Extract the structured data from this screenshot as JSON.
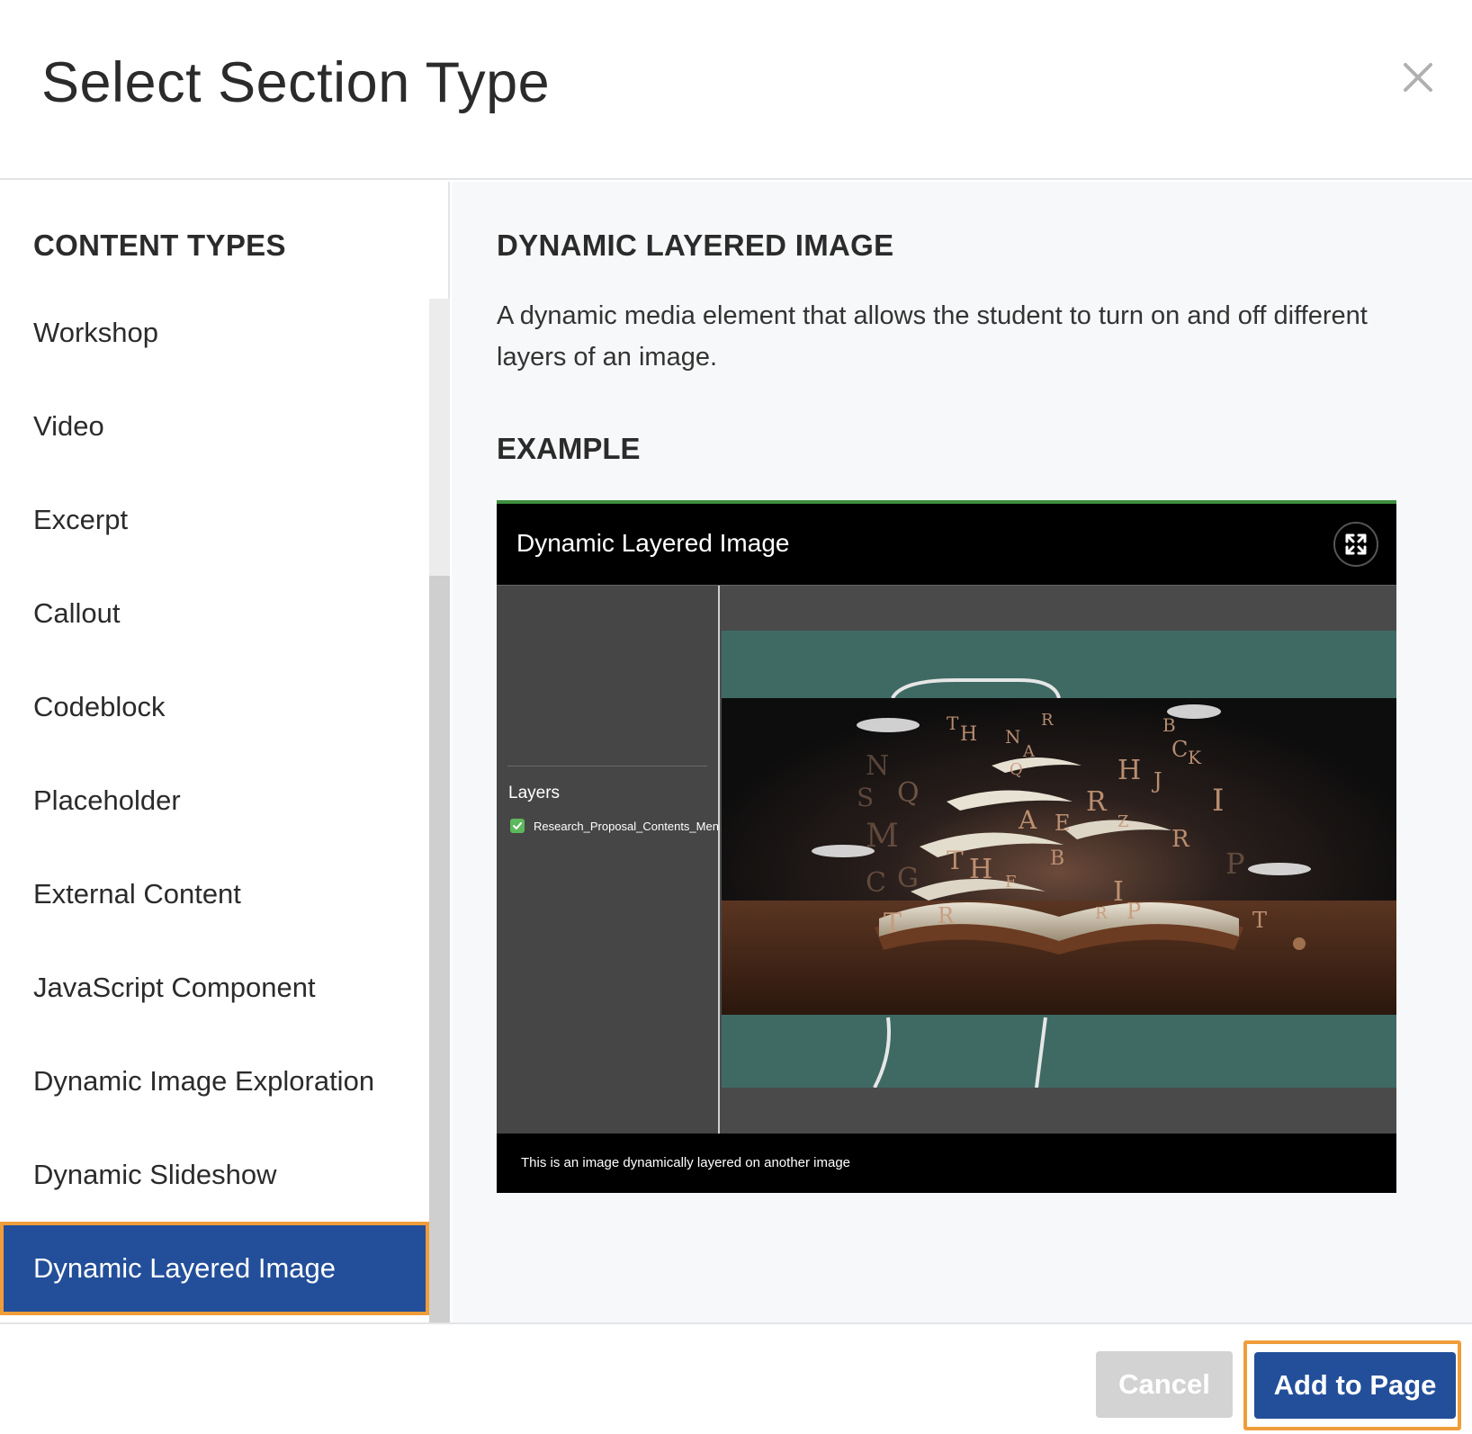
{
  "dialog": {
    "title": "Select Section Type",
    "close_icon": "close-icon"
  },
  "sidebar": {
    "heading": "CONTENT TYPES",
    "items": [
      {
        "label": "Workshop"
      },
      {
        "label": "Video"
      },
      {
        "label": "Excerpt"
      },
      {
        "label": "Callout"
      },
      {
        "label": "Codeblock"
      },
      {
        "label": "Placeholder"
      },
      {
        "label": "External Content"
      },
      {
        "label": "JavaScript Component"
      },
      {
        "label": "Dynamic Image Exploration"
      },
      {
        "label": "Dynamic Slideshow"
      },
      {
        "label": "Dynamic Layered Image"
      }
    ],
    "selected_item": "Dynamic Layered Image"
  },
  "detail": {
    "title": "DYNAMIC LAYERED IMAGE",
    "description": "A dynamic media element that allows the student to turn on and off different layers of an image.",
    "example_heading": "EXAMPLE",
    "example": {
      "title": "Dynamic Layered Image",
      "expand_icon": "expand-icon",
      "layers_label": "Layers",
      "layer_name": "Research_Proposal_Contents_Menu_",
      "layer_checked": true,
      "caption": "This is an image dynamically layered on another image"
    }
  },
  "footer": {
    "cancel_label": "Cancel",
    "add_label": "Add to Page"
  },
  "colors": {
    "primary": "#234f9a",
    "highlight": "#ef9d3a",
    "cancel_disabled": "#d3d3d3",
    "example_accent": "#3e8e3e"
  }
}
